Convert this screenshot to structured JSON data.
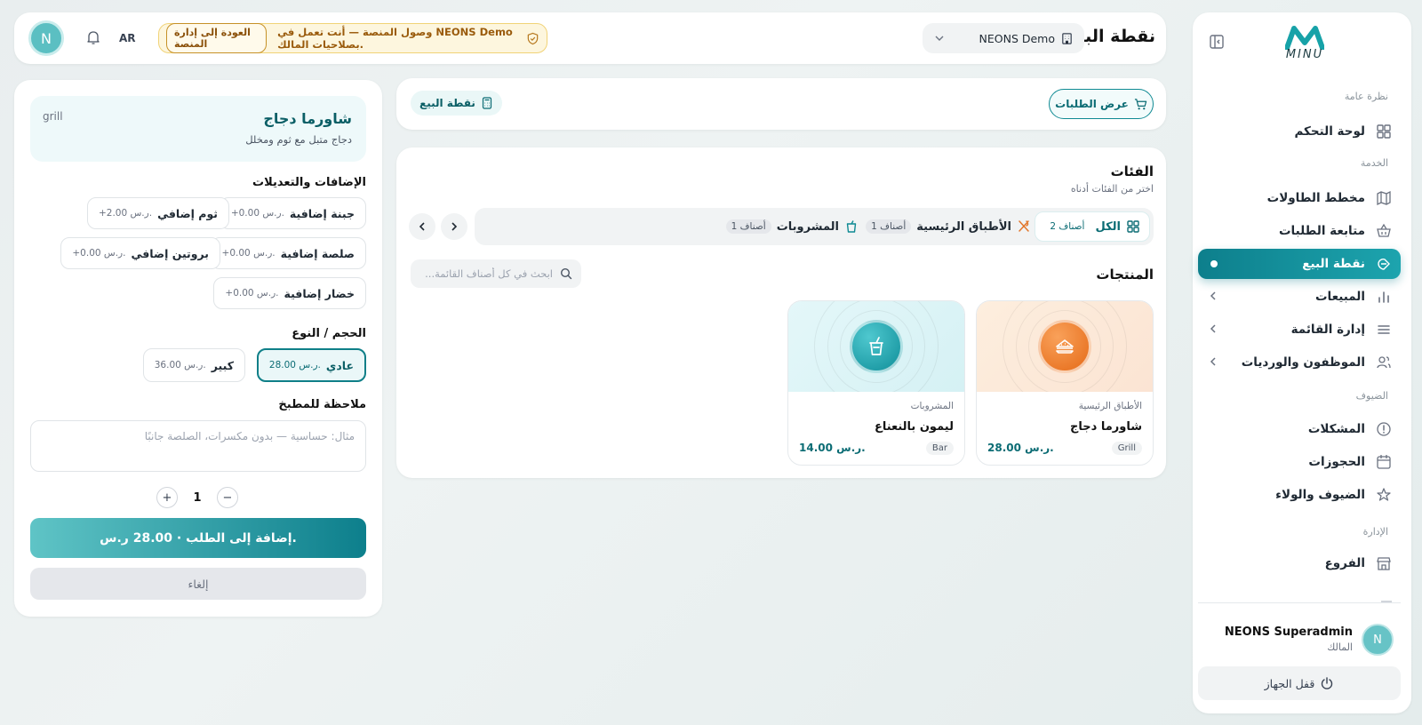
{
  "colors": {
    "accent": "#0d7f8c",
    "warning_bg": "#fdf6de",
    "beef_orange": "#f07a26",
    "bar_teal": "#1aa2ad"
  },
  "sidebar": {
    "logo_text": "MINU",
    "sections": {
      "overview": "نظرة عامة",
      "service": "الخدمة",
      "guests": "الضيوف",
      "admin": "الإدارة"
    },
    "items": [
      {
        "label": "لوحة التحكم",
        "icon": "dashboard-icon"
      },
      {
        "label": "مخطط الطاولات",
        "icon": "map-icon"
      },
      {
        "label": "متابعة الطلبات",
        "icon": "basket-icon"
      },
      {
        "label": "نقطة البيع",
        "icon": "pos-icon",
        "active": true
      },
      {
        "label": "المبيعات",
        "icon": "bar-chart-icon",
        "expandable": true
      },
      {
        "label": "إدارة القائمة",
        "icon": "menu-list-icon",
        "expandable": true
      },
      {
        "label": "الموظفون والورديات",
        "icon": "users-icon",
        "expandable": true
      },
      {
        "label": "المشكلات",
        "icon": "alert-circle-icon"
      },
      {
        "label": "الحجوزات",
        "icon": "calendar-icon"
      },
      {
        "label": "الضيوف والولاء",
        "icon": "star-icon"
      },
      {
        "label": "الفروع",
        "icon": "store-icon"
      }
    ],
    "user": {
      "initial": "N",
      "name": "NEONS Superadmin",
      "role": "المالك"
    },
    "lock_label": "قفل الجهاز"
  },
  "topbar": {
    "page_title": "نقطة البيع",
    "branch": "NEONS Demo",
    "banner_text": "وصول المنصة — أنت تعمل في NEONS Demo بصلاحيات المالك.",
    "banner_back": "العودة إلى إدارة المنصة",
    "lang": "AR",
    "avatar": "N"
  },
  "toolbar": {
    "orders_button": "عرض الطلبات",
    "pos_label": "نقطة البيع"
  },
  "categories": {
    "title": "الفئات",
    "subtitle": "اختر من الفئات أدناه",
    "tabs": [
      {
        "label": "الكل",
        "count": "2 أصناف",
        "icon": "grid-icon",
        "active": true
      },
      {
        "label": "الأطباق الرئيسية",
        "count": "1 أصناف",
        "icon": "utensils-icon"
      },
      {
        "label": "المشروبات",
        "count": "1 أصناف",
        "icon": "cup-icon"
      }
    ]
  },
  "products": {
    "title": "المنتجات",
    "search_placeholder": "ابحث في كل أصناف القائمة...",
    "items": [
      {
        "category": "الأطباق الرئيسية",
        "name": "شاورما دجاج",
        "price": "28.00 ر.س.",
        "tag": "Grill",
        "icon": "sandwich-icon"
      },
      {
        "category": "المشروبات",
        "name": "ليمون بالنعناع",
        "price": "14.00 ر.س.",
        "tag": "Bar",
        "icon": "drink-icon"
      }
    ]
  },
  "detail": {
    "title": "شاورما دجاج",
    "description": "دجاج متبل مع ثوم ومخلل",
    "station": "grill",
    "addons_title": "الإضافات والتعديلات",
    "addons": [
      {
        "name": "جبنة إضافية",
        "price": "+0.00 ر.س."
      },
      {
        "name": "ثوم إضافي",
        "price": "+2.00 ر.س."
      },
      {
        "name": "صلصة إضافية",
        "price": "+0.00 ر.س."
      },
      {
        "name": "بروتين إضافي",
        "price": "+0.00 ر.س."
      },
      {
        "name": "خضار إضافية",
        "price": "+0.00 ر.س."
      }
    ],
    "size_title": "الحجم / النوع",
    "sizes": [
      {
        "name": "عادي",
        "price": "28.00 ر.س.",
        "selected": true
      },
      {
        "name": "كبير",
        "price": "36.00 ر.س."
      }
    ],
    "note_title": "ملاحظة للمطبخ",
    "note_placeholder": "مثال: حساسية — بدون مكسرات، الصلصة جانبًا",
    "quantity": "1",
    "add_button": "إضافة إلى الطلب · 28.00 ر.س.",
    "cancel_button": "إلغاء"
  }
}
